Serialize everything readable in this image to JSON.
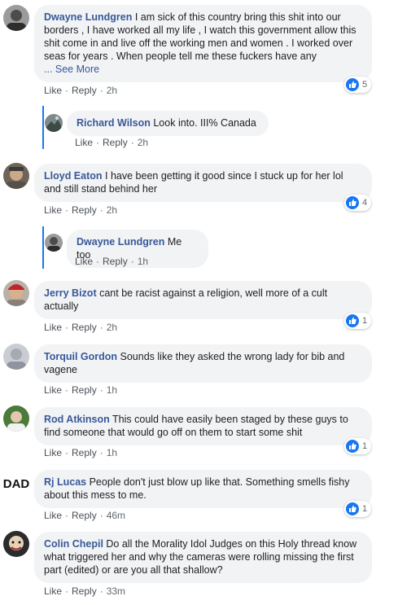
{
  "comments": [
    {
      "name": "Dwayne Lundgren",
      "text": "I am sick of this country bring this shit into our borders , I have worked all my life , I watch this government allow this shit come in and live off the working men and women . I worked over seas for years . When people tell me these fuckers have any",
      "see_more": "... See More",
      "like": "Like",
      "reply": "Reply",
      "time": "2h",
      "reactions": "5"
    },
    {
      "name": "Richard Wilson",
      "text": "Look into. III% Canada",
      "like": "Like",
      "reply": "Reply",
      "time": "2h"
    },
    {
      "name": "Lloyd Eaton",
      "text": "I have been getting it good since I stuck up for her lol and still stand behind her",
      "like": "Like",
      "reply": "Reply",
      "time": "2h",
      "reactions": "4"
    },
    {
      "name": "Dwayne Lundgren",
      "text": "Me too",
      "like": "Like",
      "reply": "Reply",
      "time": "1h"
    },
    {
      "name": "Jerry Bizot",
      "text": "cant be racist against a religion, well more of a cult actually",
      "like": "Like",
      "reply": "Reply",
      "time": "2h",
      "reactions": "1"
    },
    {
      "name": "Torquil Gordon",
      "text": "Sounds like they asked the wrong lady for bib and vagene",
      "like": "Like",
      "reply": "Reply",
      "time": "1h"
    },
    {
      "name": "Rod Atkinson",
      "text": "This could have easily been staged by these guys to find someone that would go off on them to start some shit",
      "like": "Like",
      "reply": "Reply",
      "time": "1h",
      "reactions": "1"
    },
    {
      "name": "Rj Lucas",
      "text": "People don't just blow up like that. Something smells fishy about this mess to me.",
      "avatar_text": "DAD",
      "like": "Like",
      "reply": "Reply",
      "time": "46m",
      "reactions": "1"
    },
    {
      "name": "Colin Chepil",
      "text": "Do all the Morality Idol Judges on this Holy thread know what triggered her and why the cameras were rolling missing the first part (edited) or are you all that shallow?",
      "like": "Like",
      "reply": "Reply",
      "time": "33m"
    }
  ],
  "colors": {
    "bubble": "#f2f3f5",
    "name": "#385898",
    "like_badge": "#1877f2",
    "reply_line": "#1877f2"
  },
  "icons": {
    "reaction": "thumbs-up-icon"
  }
}
